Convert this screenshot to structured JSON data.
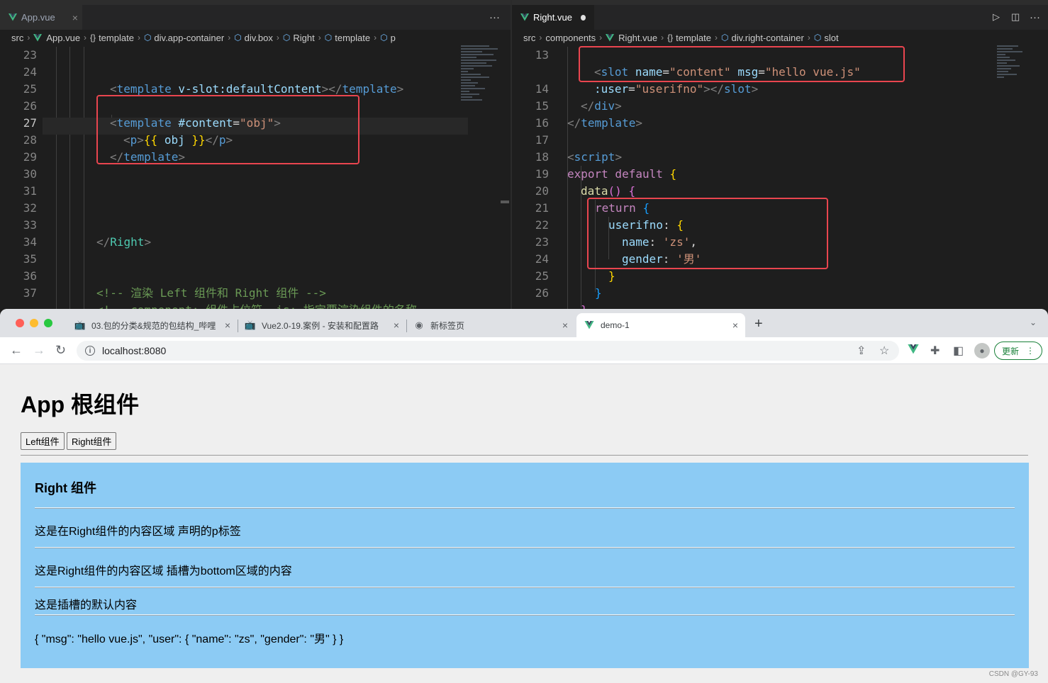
{
  "colors": {
    "vue_green": "#41b883",
    "vue_dark": "#35495e",
    "highlight_red": "#e9454f",
    "right_box_bg": "#8ccbf4",
    "update_green": "#188038"
  },
  "left_editor": {
    "tab_label": "App.vue",
    "tab_close": "×",
    "more_actions": "···",
    "breadcrumbs": [
      "src",
      "App.vue",
      "template",
      "div.app-container",
      "div.box",
      "Right",
      "template",
      "p"
    ],
    "lines": [
      {
        "n": "23",
        "current": false
      },
      {
        "n": "24",
        "current": false
      },
      {
        "n": "25",
        "current": false
      },
      {
        "n": "26",
        "current": false
      },
      {
        "n": "27",
        "current": true
      },
      {
        "n": "28",
        "current": false
      },
      {
        "n": "29",
        "current": false
      },
      {
        "n": "30",
        "current": false
      },
      {
        "n": "31",
        "current": false
      },
      {
        "n": "32",
        "current": false
      },
      {
        "n": "33",
        "current": false
      },
      {
        "n": "34",
        "current": false
      },
      {
        "n": "35",
        "current": false
      },
      {
        "n": "36",
        "current": false
      },
      {
        "n": "37",
        "current": false
      }
    ],
    "code": {
      "l24_attr": "v-slot:defaultContent",
      "l26_attr": "#content",
      "l26_val": "\"obj\"",
      "l27_expr": "obj",
      "l33_tag": "Right",
      "l36_comment": "<!-- 渲染 Left 组件和 Right 组件 -->",
      "l37_comment": "<!-- component: 组件占位符, is: 指定要渲染组件的名称"
    }
  },
  "right_editor": {
    "tab_label": "Right.vue",
    "breadcrumbs": [
      "src",
      "components",
      "Right.vue",
      "template",
      "div.right-container",
      "slot"
    ],
    "lines": [
      {
        "n": "13"
      },
      {
        "n": ""
      },
      {
        "n": "14"
      },
      {
        "n": "15"
      },
      {
        "n": "16"
      },
      {
        "n": "17"
      },
      {
        "n": "18"
      },
      {
        "n": "19"
      },
      {
        "n": "20"
      },
      {
        "n": "21"
      },
      {
        "n": "22"
      },
      {
        "n": "23"
      },
      {
        "n": "24"
      },
      {
        "n": "25"
      },
      {
        "n": "26"
      }
    ],
    "code": {
      "l13_name_attr": "name",
      "l13_name_val": "\"content\"",
      "l13_msg_attr": "msg",
      "l13_msg_val": "\"hello vue.js\"",
      "l13b_user_attr": ":user",
      "l13b_user_val": "\"userifno\"",
      "l18_export": "export default",
      "l19_fn": "data",
      "l20_return": "return",
      "l21_key": "userifno",
      "l22_key": "name",
      "l22_val": "'zs'",
      "l23_key": "gender",
      "l23_val": "'男'"
    }
  },
  "browser": {
    "tabs": [
      {
        "title": "03.包的分类&规范的包结构_哔哩",
        "close": "×"
      },
      {
        "title": "Vue2.0-19.案例 - 安装和配置路",
        "close": "×"
      },
      {
        "title": "新标签页",
        "close": "×"
      },
      {
        "title": "demo-1",
        "close": "×"
      }
    ],
    "new_tab": "+",
    "url": "localhost:8080",
    "update_label": "更新",
    "page": {
      "title": "App 根组件",
      "button_left": "Left组件",
      "button_right": "Right组件",
      "right_title": "Right 组件",
      "p1": "这是在Right组件的内容区域 声明的p标签",
      "p2": "这是Right组件的内容区域 插槽为bottom区域的内容",
      "p3": "这是插槽的默认内容",
      "p4": "{ \"msg\": \"hello vue.js\", \"user\": { \"name\": \"zs\", \"gender\": \"男\" } }"
    }
  },
  "watermark": "CSDN @GY-93"
}
